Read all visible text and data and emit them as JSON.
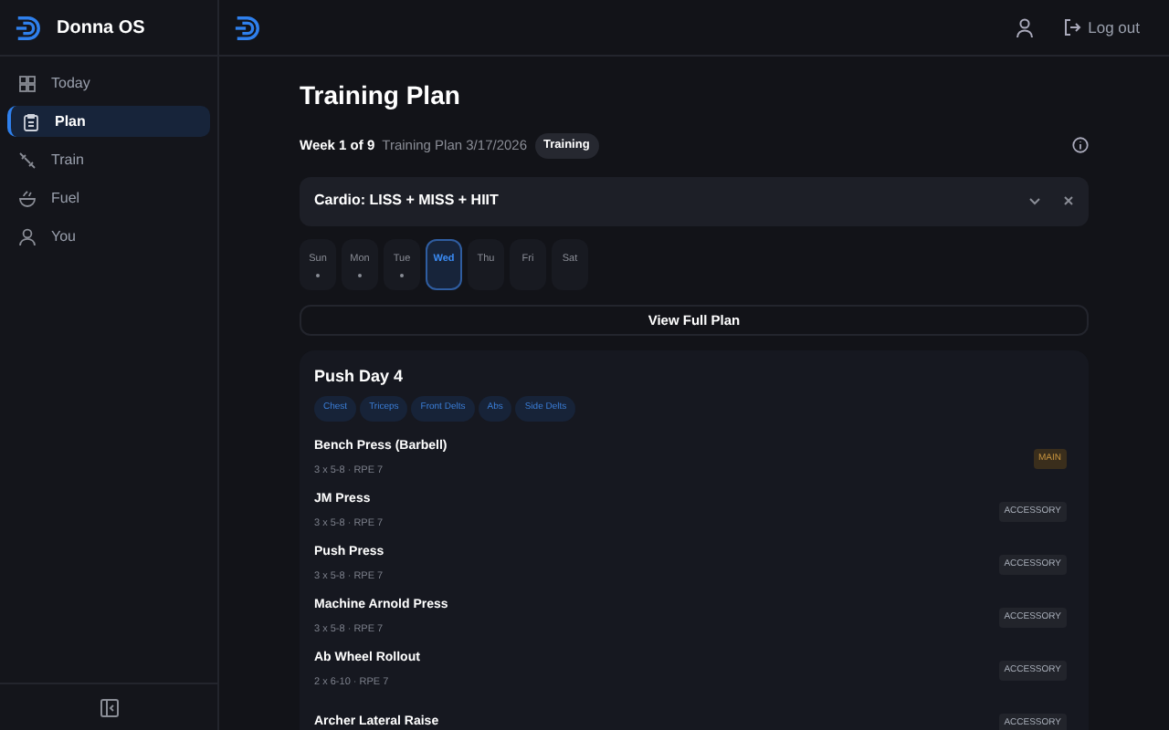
{
  "app": {
    "name": "Donna OS"
  },
  "nav": [
    {
      "label": "Today",
      "selected": false
    },
    {
      "label": "Plan",
      "selected": true
    },
    {
      "label": "Train",
      "selected": false
    },
    {
      "label": "Fuel",
      "selected": false
    },
    {
      "label": "You",
      "selected": false
    }
  ],
  "header": {
    "logout": "Log out"
  },
  "page": {
    "title": "Training Plan",
    "week": "Week 1 of 9",
    "plan": "Training Plan 3/17/2026",
    "badge": "Training"
  },
  "banner": {
    "title": "Cardio: LISS + MISS + HIIT"
  },
  "days": [
    {
      "label": "Sun",
      "selected": false,
      "has_workout": true
    },
    {
      "label": "Mon",
      "selected": false,
      "has_workout": true
    },
    {
      "label": "Tue",
      "selected": false,
      "has_workout": true
    },
    {
      "label": "Wed",
      "selected": true,
      "has_workout": false
    },
    {
      "label": "Thu",
      "selected": false,
      "has_workout": false
    },
    {
      "label": "Fri",
      "selected": false,
      "has_workout": false
    },
    {
      "label": "Sat",
      "selected": false,
      "has_workout": false
    }
  ],
  "view_full_plan": "View Full Plan",
  "workout": {
    "title": "Push Day 4",
    "muscles": [
      "Chest",
      "Triceps",
      "Front Delts",
      "Abs",
      "Side Delts"
    ],
    "exercises": [
      {
        "name": "Bench Press (Barbell)",
        "detail": "3 x 5-8 · RPE 7",
        "tag": "MAIN",
        "kind": "main"
      },
      {
        "name": "JM Press",
        "detail": "3 x 5-8 · RPE 7",
        "tag": "ACCESSORY",
        "kind": "accessory"
      },
      {
        "name": "Push Press",
        "detail": "3 x 5-8 · RPE 7",
        "tag": "ACCESSORY",
        "kind": "accessory"
      },
      {
        "name": "Machine Arnold Press",
        "detail": "3 x 5-8 · RPE 7",
        "tag": "ACCESSORY",
        "kind": "accessory"
      },
      {
        "name": "Ab Wheel Rollout",
        "detail": "2 x 6-10 · RPE 7",
        "tag": "ACCESSORY",
        "kind": "accessory"
      },
      {
        "name": "Archer Lateral Raise",
        "tag": "ACCESSORY",
        "kind": "accessory"
      }
    ]
  }
}
